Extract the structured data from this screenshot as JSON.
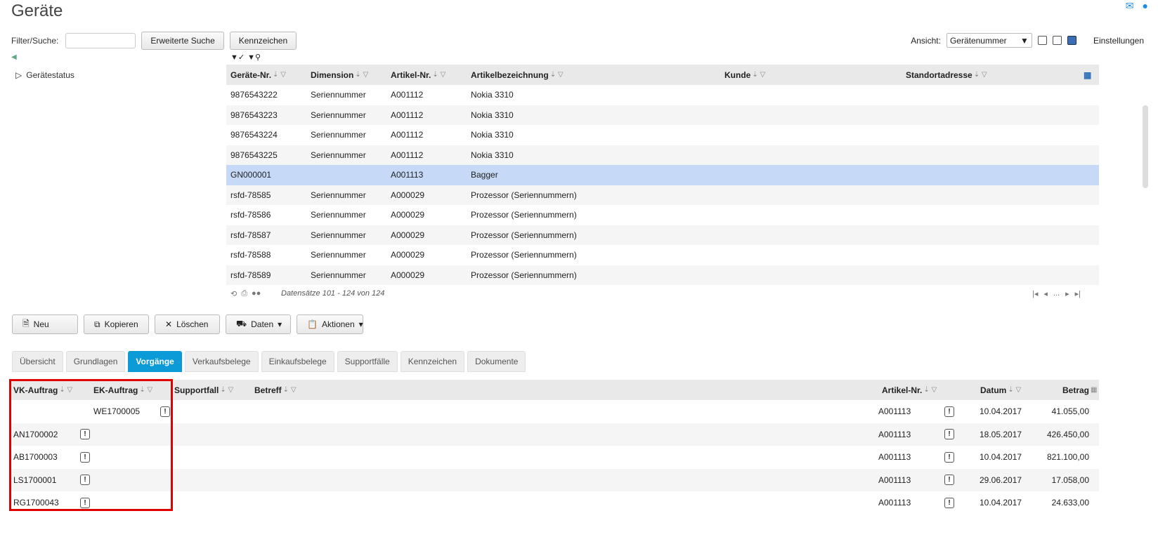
{
  "page": {
    "title": "Geräte"
  },
  "top_icons": [
    "mail-icon",
    "help-icon"
  ],
  "filter": {
    "label": "Filter/Suche:",
    "search_value": "",
    "advanced_search_label": "Erweiterte Suche",
    "tags_label": "Kennzeichen"
  },
  "view": {
    "label": "Ansicht:",
    "selected": "Gerätenummer",
    "settings_label": "Einstellungen"
  },
  "tree": {
    "item_label": "Gerätestatus"
  },
  "top_grid": {
    "columns": [
      "Geräte-Nr.",
      "Dimension",
      "Artikel-Nr.",
      "Artikelbezeichnung",
      "Kunde",
      "Standortadresse"
    ],
    "rows": [
      [
        "9876543222",
        "Seriennummer",
        "A001112",
        "Nokia 3310",
        "",
        ""
      ],
      [
        "9876543223",
        "Seriennummer",
        "A001112",
        "Nokia 3310",
        "",
        ""
      ],
      [
        "9876543224",
        "Seriennummer",
        "A001112",
        "Nokia 3310",
        "",
        ""
      ],
      [
        "9876543225",
        "Seriennummer",
        "A001112",
        "Nokia 3310",
        "",
        ""
      ],
      [
        "GN000001",
        "",
        "A001113",
        "Bagger",
        "",
        ""
      ],
      [
        "rsfd-78585",
        "Seriennummer",
        "A000029",
        "Prozessor (Seriennummern)",
        "",
        ""
      ],
      [
        "rsfd-78586",
        "Seriennummer",
        "A000029",
        "Prozessor (Seriennummern)",
        "",
        ""
      ],
      [
        "rsfd-78587",
        "Seriennummer",
        "A000029",
        "Prozessor (Seriennummern)",
        "",
        ""
      ],
      [
        "rsfd-78588",
        "Seriennummer",
        "A000029",
        "Prozessor (Seriennummern)",
        "",
        ""
      ],
      [
        "rsfd-78589",
        "Seriennummer",
        "A000029",
        "Prozessor (Seriennummern)",
        "",
        ""
      ]
    ],
    "selected_row": 4,
    "footer_info": "Datensätze 101 - 124 von 124",
    "pager_more": "..."
  },
  "actions": {
    "new_label": "Neu",
    "copy_label": "Kopieren",
    "delete_label": "Löschen",
    "data_label": "Daten",
    "actions_label": "Aktionen"
  },
  "tabs": [
    "Übersicht",
    "Grundlagen",
    "Vorgänge",
    "Verkaufsbelege",
    "Einkaufsbelege",
    "Supportfälle",
    "Kennzeichen",
    "Dokumente"
  ],
  "active_tab": "Vorgänge",
  "bottom_grid": {
    "columns": [
      "VK-Auftrag",
      "EK-Auftrag",
      "Supportfall",
      "Betreff",
      "Artikel-Nr.",
      "Datum",
      "Betrag"
    ],
    "rows": [
      [
        "",
        "WE1700005",
        "",
        "",
        "A001113",
        "10.04.2017",
        "41.055,00"
      ],
      [
        "AN1700002",
        "",
        "",
        "",
        "A001113",
        "18.05.2017",
        "426.450,00"
      ],
      [
        "AB1700003",
        "",
        "",
        "",
        "A001113",
        "10.04.2017",
        "821.100,00"
      ],
      [
        "LS1700001",
        "",
        "",
        "",
        "A001113",
        "29.06.2017",
        "17.058,00"
      ],
      [
        "RG1700043",
        "",
        "",
        "",
        "A001113",
        "10.04.2017",
        "24.633,00"
      ]
    ]
  },
  "colors": {
    "accent": "#0d9bd8",
    "selected_row": "#c6daf8",
    "highlight": "#e00000"
  }
}
